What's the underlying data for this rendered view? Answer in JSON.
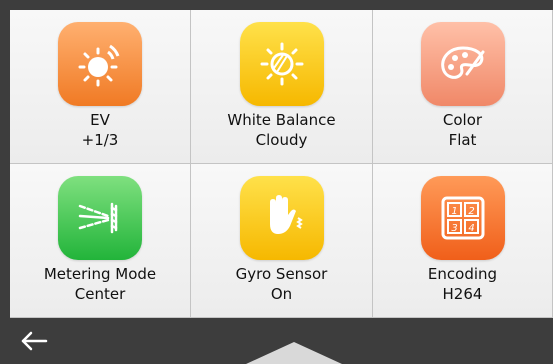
{
  "tiles": [
    {
      "name": "EV",
      "value": "+1/3",
      "icon": "sun-icon"
    },
    {
      "name": "White Balance",
      "value": "Cloudy",
      "icon": "white-balance-icon"
    },
    {
      "name": "Color",
      "value": "Flat",
      "icon": "palette-icon"
    },
    {
      "name": "Metering Mode",
      "value": "Center",
      "icon": "metering-icon"
    },
    {
      "name": "Gyro Sensor",
      "value": "On",
      "icon": "gyro-hand-icon"
    },
    {
      "name": "Encoding",
      "value": "H264",
      "icon": "encoding-grid-icon",
      "grid_labels": [
        "1",
        "2",
        "3",
        "4"
      ]
    }
  ],
  "colors": {
    "background": "#3d3d3d",
    "tile": "#f4f4f4",
    "orange": "#f07a24",
    "yellow": "#f6b800",
    "salmon": "#f08868",
    "green": "#22b43a"
  },
  "nav": {
    "back_icon": "back-arrow-icon",
    "up_icon": "expand-up-icon"
  }
}
